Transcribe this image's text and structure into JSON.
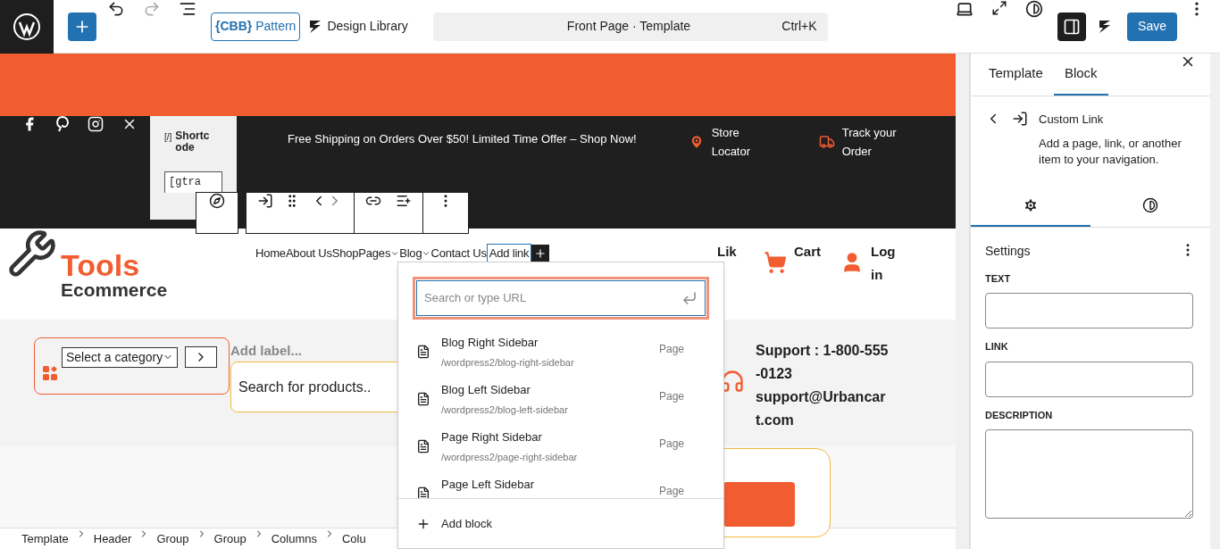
{
  "topbar": {
    "pattern_logo": "{CBB}",
    "pattern_label": "Pattern",
    "design_library": "Design Library",
    "command": {
      "title": "Front Page · Template",
      "shortcut": "Ctrl+K"
    },
    "settings_toggle_on": true,
    "save": "Save"
  },
  "canvas": {
    "shortcode": {
      "icon": "[/]",
      "title": "Shortcode",
      "code": "[gtra"
    },
    "promo": "Free Shipping on Orders Over $50! Limited Time Offer – Shop Now!",
    "store_locator": "Store Locator",
    "track_order": "Track your Order",
    "logo": {
      "line1": "Tools",
      "line2": "Ecommerce"
    },
    "nav": [
      {
        "label": "Home",
        "submenu": false
      },
      {
        "label": "About Us",
        "submenu": false
      },
      {
        "label": "Shop",
        "submenu": false
      },
      {
        "label": "Pages",
        "submenu": true
      },
      {
        "label": "Blog",
        "submenu": true
      },
      {
        "label": "Contact Us",
        "submenu": false
      }
    ],
    "add_link": "Add link",
    "actions": [
      {
        "kind": "like",
        "label": "Lik"
      },
      {
        "kind": "cart",
        "label": "Cart"
      },
      {
        "kind": "login",
        "label": "Login"
      }
    ],
    "category_select": "Select a category",
    "add_label": "Add label...",
    "search_placeholder": "Search for products..",
    "support": {
      "phone": "Support : 1-800-555-0123",
      "email": "support@Urbancart.com"
    }
  },
  "link_popover": {
    "placeholder": "Search or type URL",
    "results": [
      {
        "title": "Blog Right Sidebar",
        "url": "/wordpress2/blog-right-sidebar",
        "type": "Page"
      },
      {
        "title": "Blog Left Sidebar",
        "url": "/wordpress2/blog-left-sidebar",
        "type": "Page"
      },
      {
        "title": "Page Right Sidebar",
        "url": "/wordpress2/page-right-sidebar",
        "type": "Page"
      },
      {
        "title": "Page Left Sidebar",
        "type": "Page"
      }
    ],
    "add_block": "Add block"
  },
  "breadcrumb": [
    "Template",
    "Header",
    "Group",
    "Group",
    "Columns",
    "Colu"
  ],
  "sidebar": {
    "tabs": [
      {
        "label": "Template",
        "selected": false
      },
      {
        "label": "Block",
        "selected": true
      }
    ],
    "block": {
      "title": "Custom Link",
      "description": "Add a page, link, or another item to your navigation."
    },
    "subtabs": [
      {
        "kind": "settings",
        "selected": true
      },
      {
        "kind": "styles",
        "selected": false
      }
    ],
    "section": "Settings",
    "fields": [
      {
        "label": "TEXT",
        "kind": "input"
      },
      {
        "label": "LINK",
        "kind": "input"
      },
      {
        "label": "DESCRIPTION",
        "kind": "textarea"
      }
    ]
  }
}
